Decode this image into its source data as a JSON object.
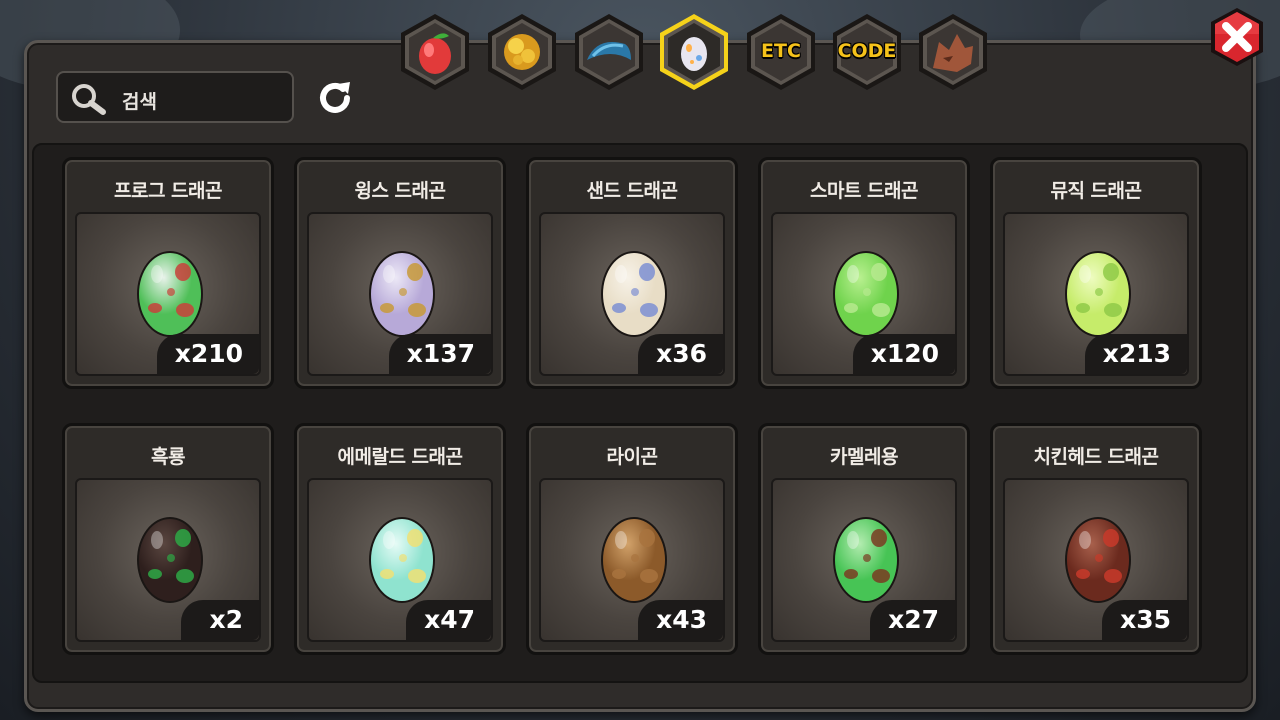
{
  "search": {
    "placeholder": "검색"
  },
  "tabs": [
    {
      "name": "tab-fruit",
      "label": "",
      "icon": "fruit-icon",
      "selected": false
    },
    {
      "name": "tab-gold",
      "label": "",
      "icon": "gold-icon",
      "selected": false
    },
    {
      "name": "tab-scale",
      "label": "",
      "icon": "scale-icon",
      "selected": false
    },
    {
      "name": "tab-egg",
      "label": "",
      "icon": "egg-icon",
      "selected": true
    },
    {
      "name": "tab-etc",
      "label": "ETC",
      "icon": "",
      "selected": false
    },
    {
      "name": "tab-code",
      "label": "CODE",
      "icon": "",
      "selected": false
    },
    {
      "name": "tab-dragon",
      "label": "",
      "icon": "dragon-head-icon",
      "selected": false
    }
  ],
  "items": [
    {
      "name": "프로그 드래곤",
      "count": "x210",
      "base": "#4fbf58",
      "spot": "#c8413b",
      "top": "#e8f2ea"
    },
    {
      "name": "윙스 드래곤",
      "count": "x137",
      "base": "#b7a9d8",
      "spot": "#c89a38",
      "top": "#ece8f6"
    },
    {
      "name": "샌드 드래곤",
      "count": "x36",
      "base": "#e8ddc6",
      "spot": "#7d8fd2",
      "top": "#f7f2e8"
    },
    {
      "name": "스마트 드래곤",
      "count": "x120",
      "base": "#6fd34c",
      "spot": "#b6e98e",
      "top": "#b9f090"
    },
    {
      "name": "뮤직 드래곤",
      "count": "x213",
      "base": "#c6ec6a",
      "spot": "#8fca48",
      "top": "#eefcc0"
    },
    {
      "name": "흑룡",
      "count": "x2",
      "base": "#2e1f1d",
      "spot": "#2ea845",
      "top": "#5a4640"
    },
    {
      "name": "에메랄드 드래곤",
      "count": "x47",
      "base": "#8fe3cf",
      "spot": "#f0e074",
      "top": "#e6fbf6"
    },
    {
      "name": "라이곤",
      "count": "x43",
      "base": "#8c5a2a",
      "spot": "#a8733e",
      "top": "#d2a26a"
    },
    {
      "name": "카멜레용",
      "count": "x27",
      "base": "#47c455",
      "spot": "#7a3b22",
      "top": "#b3ecb0"
    },
    {
      "name": "치킨헤드 드래곤",
      "count": "x35",
      "base": "#6b2a1e",
      "spot": "#c83a2a",
      "top": "#a8604c"
    }
  ],
  "colors": {
    "accent": "#f5c21a",
    "close": "#d9262e",
    "panel": "#2f2c2a"
  }
}
